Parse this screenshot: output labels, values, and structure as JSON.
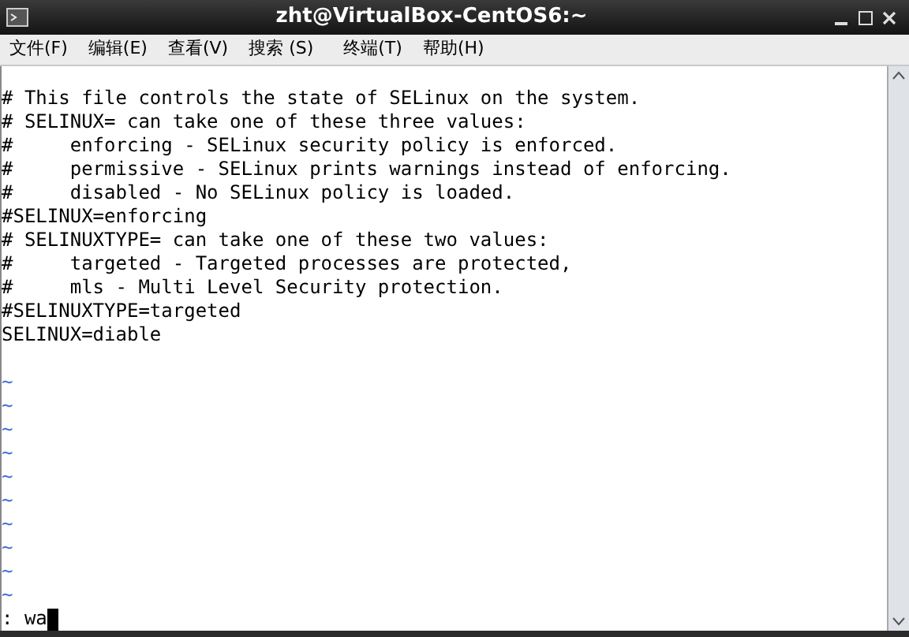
{
  "window": {
    "title": "zht@VirtualBox-CentOS6:~"
  },
  "menu": [
    "文件(F)",
    "编辑(E)",
    "查看(V)",
    "搜索 (S)",
    "终端(T)",
    "帮助(H)"
  ],
  "editor": {
    "lines": [
      "# This file controls the state of SELinux on the system.",
      "# SELINUX= can take one of these three values:",
      "#     enforcing - SELinux security policy is enforced.",
      "#     permissive - SELinux prints warnings instead of enforcing.",
      "#     disabled - No SELinux policy is loaded.",
      "#SELINUX=enforcing",
      "# SELINUXTYPE= can take one of these two values:",
      "#     targeted - Targeted processes are protected,",
      "#     mls - Multi Level Security protection.",
      "#SELINUXTYPE=targeted",
      "SELINUX=diable"
    ],
    "tildes": [
      "~",
      "~",
      "~",
      "~",
      "~",
      "~",
      "~",
      "~",
      "~",
      "~"
    ],
    "command": ": wa"
  }
}
